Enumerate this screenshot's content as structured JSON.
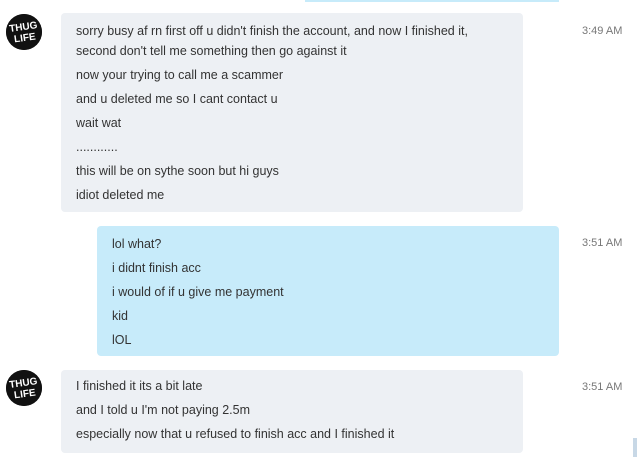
{
  "conversation": {
    "messages": [
      {
        "sender": "other",
        "time": "3:49 AM",
        "avatar_text": [
          "THUG",
          "LIFE"
        ],
        "lines": [
          "sorry busy af rn first off u didn't finish the account, and now I finished it, second don't tell me something then go against it",
          "now your trying to call me a scammer",
          "and u deleted me so I cant contact u",
          "wait wat",
          "............",
          "this will be on sythe soon but hi guys",
          "idiot deleted me"
        ]
      },
      {
        "sender": "me",
        "time": "3:51 AM",
        "lines": [
          "lol what?",
          "i didnt finish acc",
          "i would of if u give me payment",
          "kid",
          "lOL"
        ]
      },
      {
        "sender": "other",
        "time": "3:51 AM",
        "avatar_text": [
          "THUG",
          "LIFE"
        ],
        "lines": [
          "I finished it its a bit late",
          "and I told u I'm not paying 2.5m",
          "especially now that u refused to finish acc and I finished it"
        ]
      }
    ]
  },
  "colors": {
    "incoming_bubble": "#edf0f4",
    "outgoing_bubble": "#c7ebfa",
    "text": "#333333",
    "timestamp": "#777777",
    "avatar_background": "#111111"
  },
  "icons": {
    "avatar": "thug-life-avatar-icon"
  }
}
